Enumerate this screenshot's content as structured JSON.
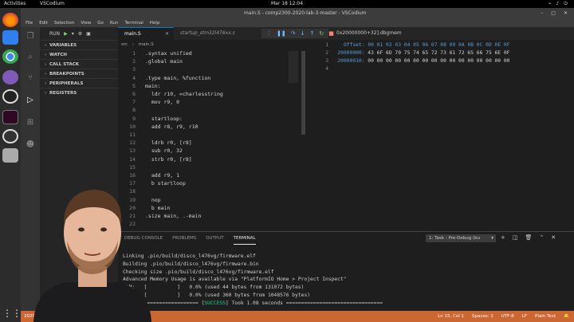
{
  "topbar": {
    "activities": "Activities",
    "app_name": "VSCodium",
    "clock": "Mar 18  12:04"
  },
  "window": {
    "title": "main.S - comp2300-2020-lab-3-master - VSCodium"
  },
  "menu": [
    "File",
    "Edit",
    "Selection",
    "View",
    "Go",
    "Run",
    "Terminal",
    "Help"
  ],
  "sidebar": {
    "run_label": "RUN",
    "sections": [
      {
        "label": "VARIABLES"
      },
      {
        "label": "WATCH"
      },
      {
        "label": "CALL STACK"
      },
      {
        "label": "BREAKPOINTS"
      },
      {
        "label": "PERIPHERALS"
      },
      {
        "label": "REGISTERS"
      }
    ]
  },
  "tabs": [
    {
      "label": "main.S"
    },
    {
      "label": "startup_stm32l476xx.s"
    },
    {
      "label": "0x20000000+32].dbgmem"
    }
  ],
  "breadcrumb": [
    "src",
    "main.S"
  ],
  "code_lines": [
    {
      "n": "1",
      "text": ".syntax unified"
    },
    {
      "n": "2",
      "text": ".global main"
    },
    {
      "n": "3",
      "text": ""
    },
    {
      "n": "4",
      "text": ".type main, %function"
    },
    {
      "n": "5",
      "text": "main:"
    },
    {
      "n": "6",
      "text": "  ldr r10, =charlesstring"
    },
    {
      "n": "7",
      "text": "  mov r9, 0"
    },
    {
      "n": "8",
      "text": ""
    },
    {
      "n": "9",
      "text": "  startloop:"
    },
    {
      "n": "10",
      "text": "  add r8, r9, r10"
    },
    {
      "n": "11",
      "text": ""
    },
    {
      "n": "12",
      "text": "  ldrb r0, [r8]"
    },
    {
      "n": "13",
      "text": "  sub r0, 32"
    },
    {
      "n": "14",
      "text": "  strb r0, [r8]"
    },
    {
      "n": "15",
      "text": ""
    },
    {
      "n": "16",
      "text": "  add r9, 1"
    },
    {
      "n": "17",
      "text": "  b startloop"
    },
    {
      "n": "18",
      "text": ""
    },
    {
      "n": "19",
      "text": "  nop"
    },
    {
      "n": "20",
      "text": "  b main"
    },
    {
      "n": "21",
      "text": ".size main, .-main"
    },
    {
      "n": "22",
      "text": ""
    }
  ],
  "hex": {
    "rows": [
      {
        "n": "1",
        "addr": "Offset:",
        "bytes": "00 01 02 03 04 05 06 07 08 09 0A 0B 0C 0D 0E 0F"
      },
      {
        "n": "2",
        "addr": "20000000:",
        "bytes": "43 6F 6D 70 75 74 65 72 73 61 72 65 66 75 6E 0F"
      },
      {
        "n": "3",
        "addr": "20000010:",
        "bytes": "00 00 00 00 00 00 00 00 00 00 00 00 00 00 00 00"
      },
      {
        "n": "4",
        "addr": "",
        "bytes": ""
      }
    ]
  },
  "panel": {
    "tabs": [
      "DEBUG CONSOLE",
      "PROBLEMS",
      "OUTPUT",
      "TERMINAL"
    ],
    "task": "1: Task - Pre-Debug (bu",
    "terminal_lines": [
      "Linking .pio/build/disco_l476vg/firmware.elf",
      "Building .pio/build/disco_l476vg/firmware.bin",
      "Checking size .pio/build/disco_l476vg/firmware.elf",
      "Advanced Memory Usage is available via \"PlatformIO Home > Project Inspect\"",
      "RAM:   [          ]   0.0% (used 44 bytes from 131072 bytes)",
      "Flash: [          ]   0.0% (used 360 bytes from 1048576 bytes)"
    ],
    "success_prefix": "========================= [",
    "success_word": "SUCCESS",
    "success_suffix": "] Took 1.08 seconds ================================"
  },
  "status": {
    "left": [
      "2020-lab-3-master)"
    ],
    "right": [
      "Ln 15, Col 1",
      "Spaces: 2",
      "UTF-8",
      "LF",
      "Plain Text"
    ]
  },
  "colors": {
    "accent": "#007acc",
    "status": "#cc6633",
    "success": "#23d18b"
  }
}
